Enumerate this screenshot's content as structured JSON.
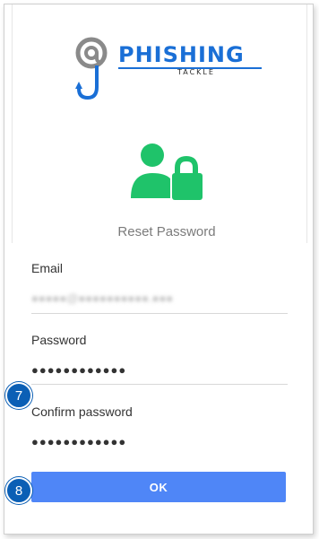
{
  "logo": {
    "brand": "PHISHING",
    "sub": "TACKLE",
    "colors": {
      "blue": "#1a6fd6",
      "grey": "#8a8a8a"
    }
  },
  "header": {
    "icon": "user-lock-icon",
    "icon_color": "#1fc36a",
    "title": "Reset Password"
  },
  "form": {
    "email": {
      "label": "Email",
      "value": "●●●●●@●●●●●●●●●●.●●●"
    },
    "password": {
      "label": "Password",
      "value": "●●●●●●●●●●●●"
    },
    "confirm": {
      "label": "Confirm password",
      "value": "●●●●●●●●●●●●"
    }
  },
  "actions": {
    "ok_label": "OK",
    "ok_color": "#4f86f7"
  },
  "annotations": {
    "step7": "7",
    "step8": "8",
    "badge_color": "#0b5fb5"
  }
}
